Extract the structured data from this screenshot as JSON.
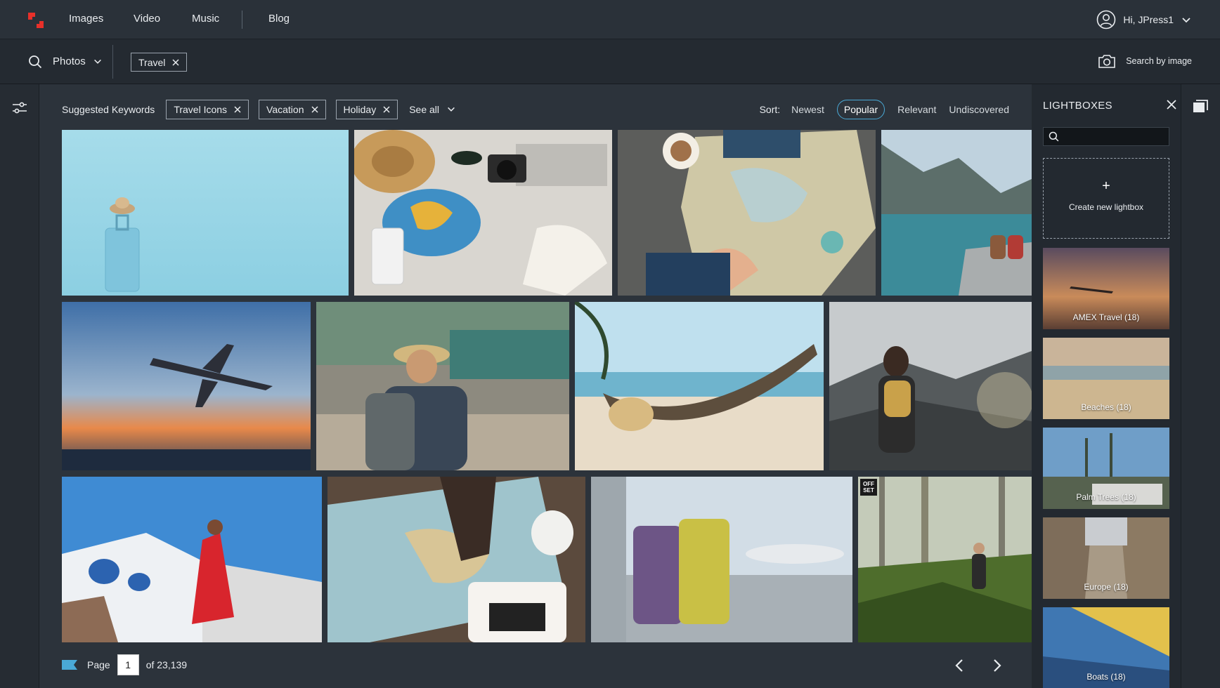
{
  "nav": {
    "links": [
      "Images",
      "Video",
      "Music",
      "Blog"
    ],
    "user_label": "Hi, JPress1"
  },
  "search": {
    "type_label": "Photos",
    "chips": [
      "Travel"
    ],
    "image_search_label": "Search by image"
  },
  "keywords": {
    "title": "Suggested Keywords",
    "items": [
      "Travel Icons",
      "Vacation",
      "Holiday"
    ],
    "see_all": "See all"
  },
  "sort": {
    "label": "Sort:",
    "options": [
      "Newest",
      "Popular",
      "Relevant",
      "Undiscovered"
    ],
    "active": "Popular"
  },
  "images": [
    {
      "subject": "Blue suitcase with hat and camera against light blue wall"
    },
    {
      "subject": "Flat lay of hat, sunglasses, camera, world map and sneakers"
    },
    {
      "subject": "Hands planning trip on paper map with coffee and toy plane"
    },
    {
      "subject": "Two hikers sitting by turquoise mountain lake"
    },
    {
      "subject": "Airplane flying over sea at sunset"
    },
    {
      "subject": "Backpacker in hat on busy market street"
    },
    {
      "subject": "Woman relaxing in hammock on beach"
    },
    {
      "subject": "Hiker with yellow backpack looking at misty mountains"
    },
    {
      "subject": "Woman in red dress in Santorini"
    },
    {
      "subject": "Hand pointing at vintage map with coffee cup"
    },
    {
      "subject": "Purple and yellow suitcases at airport window"
    },
    {
      "subject": "Hiker in misty forest with ferns",
      "badge": "OFF SET"
    }
  ],
  "pager": {
    "page_label": "Page",
    "current": "1",
    "total_label": "of 23,139"
  },
  "lightboxes": {
    "title": "LIGHTBOXES",
    "create_label": "Create new lightbox",
    "items": [
      {
        "label": "AMEX Travel (18)"
      },
      {
        "label": "Beaches (18)"
      },
      {
        "label": "Palm Trees (18)"
      },
      {
        "label": "Europe (18)"
      },
      {
        "label": "Boats (18)"
      }
    ]
  },
  "colors": {
    "accent": "#4aa9d6",
    "logo_red": "#e8302a",
    "background": "#2c333b"
  }
}
